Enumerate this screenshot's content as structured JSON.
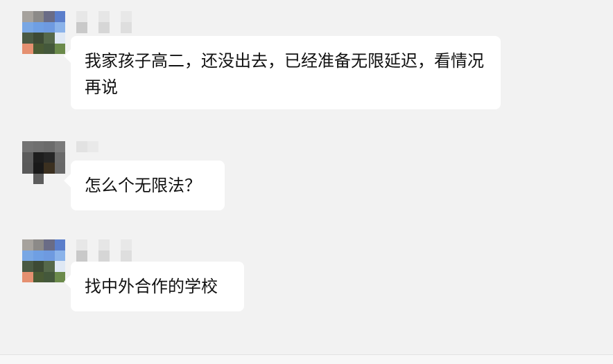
{
  "messages": [
    {
      "sender_avatar": "avatar-pixelated-1",
      "text": "我家孩子高二，还没出去，已经准备无限延迟，看情况再说"
    },
    {
      "sender_avatar": "avatar-pixelated-2",
      "text": "怎么个无限法？"
    },
    {
      "sender_avatar": "avatar-pixelated-1",
      "text": "找中外合作的学校"
    }
  ],
  "colors": {
    "background": "#f2f2f2",
    "bubble": "#ffffff",
    "text": "#111111"
  }
}
